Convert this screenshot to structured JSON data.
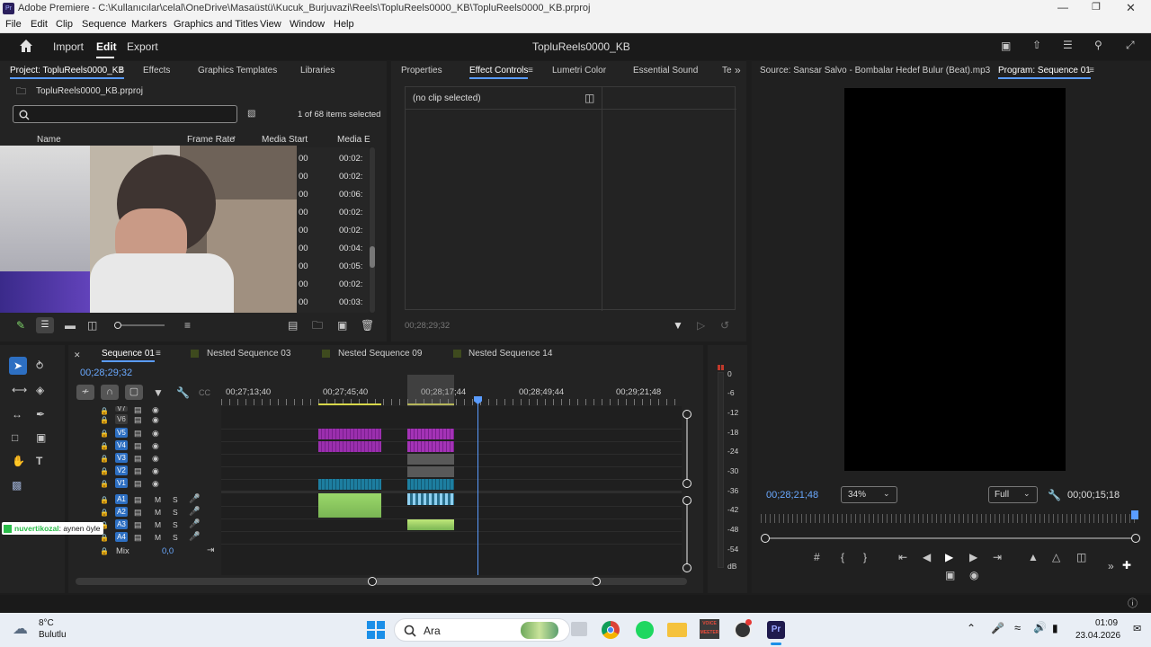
{
  "window": {
    "app_icon": "Pr",
    "title": "Adobe Premiere - C:\\Kullanıcılar\\celal\\OneDrive\\Masaüstü\\Kucuk_Burjuvazi\\Reels\\TopluReels0000_KB\\TopluReels0000_KB.prproj"
  },
  "menu": [
    "File",
    "Edit",
    "Clip",
    "Sequence",
    "Markers",
    "Graphics and Titles",
    "View",
    "Window",
    "Help"
  ],
  "header": {
    "import": "Import",
    "edit": "Edit",
    "export": "Export",
    "project_name": "TopluReels0000_KB"
  },
  "project_panel": {
    "tabs": [
      "Project: TopluReels0000_KB",
      "Effects",
      "Graphics Templates",
      "Libraries"
    ],
    "file": "TopluReels0000_KB.prproj",
    "search_placeholder": "",
    "items_selected": "1 of 68 items selected",
    "columns": [
      "Name",
      "Frame Rate",
      "Media Start",
      "Media E"
    ],
    "rows": [
      {
        "frame": "00",
        "media": "00:02:"
      },
      {
        "frame": "00",
        "media": "00:02:"
      },
      {
        "frame": "00",
        "media": "00:06:"
      },
      {
        "frame": "00",
        "media": "00:02:"
      },
      {
        "frame": "00",
        "media": "00:02:"
      },
      {
        "frame": "00",
        "media": "00:04:"
      },
      {
        "frame": "00",
        "media": "00:05:"
      },
      {
        "frame": "00",
        "media": "00:02:"
      },
      {
        "frame": "00",
        "media": "00:03:"
      }
    ]
  },
  "effect_panel": {
    "tabs": [
      "Properties",
      "Effect Controls",
      "Lumetri Color",
      "Essential Sound",
      "Te"
    ],
    "no_clip": "(no clip selected)",
    "timecode": "00;28;29;32"
  },
  "program_panel": {
    "tabs": [
      "Source: Sansar Salvo - Bombalar Hedef Bulur (Beat).mp3",
      "Program: Sequence 01"
    ],
    "timecode": "00;28;21;48",
    "zoom": "34%",
    "quality": "Full",
    "duration": "00;00;15;18"
  },
  "timeline": {
    "tabs": [
      "Sequence 01",
      "Nested Sequence 03",
      "Nested Sequence 09",
      "Nested Sequence 14"
    ],
    "timecode": "00;28;29;32",
    "ruler": [
      "00;27;13;40",
      "00;27;45;40",
      "00;28;17;44",
      "00;28;49;44",
      "00;29;21;48"
    ],
    "video_tracks": [
      "V7",
      "V6",
      "V5",
      "V4",
      "V3",
      "V2",
      "V1"
    ],
    "audio_tracks": [
      "A1",
      "A2",
      "A3",
      "A4"
    ],
    "mix_label": "Mix",
    "mix_value": "0,0",
    "m_label": "M",
    "s_label": "S"
  },
  "meters": {
    "scale": [
      "0",
      "-6",
      "-12",
      "-18",
      "-24",
      "-30",
      "-36",
      "-42",
      "-48",
      "-54",
      "dB"
    ]
  },
  "chat_overlay": {
    "user": "nuvertikozal",
    "message": ": aynen öyle"
  },
  "taskbar": {
    "weather_temp": "8°C",
    "weather_desc": "Bulutlu",
    "search": "Ara",
    "voicemeeter": "VOICE MEETER",
    "premiere": "Pr",
    "time": "01:09",
    "date": "23.04.2026"
  },
  "colors": {
    "accent": "#5a9cff",
    "video_clip": "#9b2fae",
    "audio_clip": "#86c35a",
    "blue_clip": "#1d7ea0"
  }
}
